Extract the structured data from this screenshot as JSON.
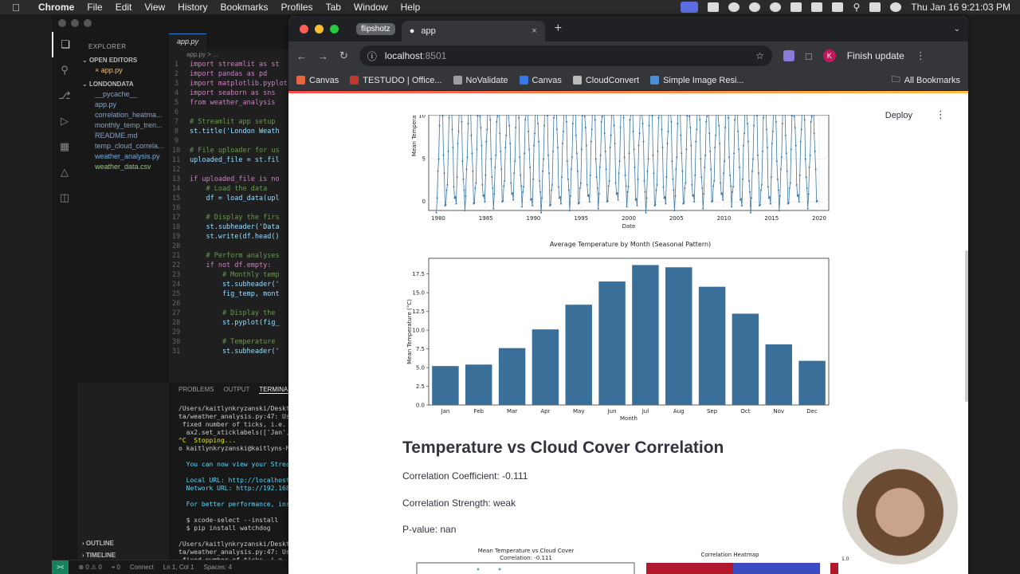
{
  "menubar": {
    "app": "Chrome",
    "items": [
      "File",
      "Edit",
      "View",
      "History",
      "Bookmarks",
      "Profiles",
      "Tab",
      "Window",
      "Help"
    ],
    "clock": "Thu Jan 16  9:21:03 PM"
  },
  "vscode": {
    "explorer_title": "EXPLORER",
    "open_editors": "OPEN EDITORS",
    "open_file": "app.py",
    "project": "LONDONDATA",
    "files": [
      "__pycache__",
      "app.py",
      "correlation_heatma...",
      "monthly_temp_tren...",
      "README.md",
      "temp_cloud_correla...",
      "weather_analysis.py",
      "weather_data.csv"
    ],
    "tab_label": "app.py",
    "breadcrumb": "app.py > ...",
    "code_lines": [
      {
        "n": "1",
        "t": "import streamlit as st"
      },
      {
        "n": "2",
        "t": "import pandas as pd"
      },
      {
        "n": "3",
        "t": "import matplotlib.pyplot"
      },
      {
        "n": "4",
        "t": "import seaborn as sns"
      },
      {
        "n": "5",
        "t": "from weather_analysis"
      },
      {
        "n": "6",
        "t": ""
      },
      {
        "n": "7",
        "t": "# Streamlit app setup"
      },
      {
        "n": "8",
        "t": "st.title('London Weath"
      },
      {
        "n": "9",
        "t": ""
      },
      {
        "n": "10",
        "t": "# File uploader for us"
      },
      {
        "n": "11",
        "t": "uploaded_file = st.fil"
      },
      {
        "n": "12",
        "t": ""
      },
      {
        "n": "13",
        "t": "if uploaded_file is no"
      },
      {
        "n": "14",
        "t": "    # Load the data"
      },
      {
        "n": "15",
        "t": "    df = load_data(upl"
      },
      {
        "n": "16",
        "t": ""
      },
      {
        "n": "17",
        "t": "    # Display the firs"
      },
      {
        "n": "18",
        "t": "    st.subheader('Data"
      },
      {
        "n": "19",
        "t": "    st.write(df.head()"
      },
      {
        "n": "20",
        "t": ""
      },
      {
        "n": "21",
        "t": "    # Perform analyses"
      },
      {
        "n": "22",
        "t": "    if not df.empty:"
      },
      {
        "n": "23",
        "t": "        # Monthly temp"
      },
      {
        "n": "24",
        "t": "        st.subheader('"
      },
      {
        "n": "25",
        "t": "        fig_temp, mont"
      },
      {
        "n": "26",
        "t": ""
      },
      {
        "n": "27",
        "t": "        # Display the"
      },
      {
        "n": "28",
        "t": "        st.pyplot(fig_"
      },
      {
        "n": "29",
        "t": ""
      },
      {
        "n": "30",
        "t": "        # Temperature"
      },
      {
        "n": "31",
        "t": "        st.subheader('"
      }
    ],
    "panel_tabs": [
      "PROBLEMS",
      "OUTPUT",
      "TERMINAL"
    ],
    "terminal_lines": [
      "/Users/kaitlynkryzanski/Deskt",
      "ta/weather_analysis.py:47: Us",
      " fixed number of ticks, i.e.",
      "  ax2.set_xticklabels(['Jan',",
      "^C  Stopping...",
      "o kaitlynkryzanski@kaitlyns-MBP",
      "",
      "  You can now view your Strea",
      "",
      "  Local URL: http://localhost",
      "  Network URL: http://192.168",
      "",
      "  For better performance, ins",
      "",
      "  $ xcode-select --install",
      "  $ pip install watchdog",
      "",
      "/Users/kaitlynkryzanski/Deskt",
      "ta/weather_analysis.py:47: Us",
      " fixed number of ticks, i.e.",
      "  ax2.set_xticklabels(['Jan',"
    ],
    "outline": "OUTLINE",
    "timeline": "TIMELINE",
    "status": {
      "errors": "0",
      "warnings": "0",
      "ports": "0",
      "connect": "Connect",
      "position": "Ln 1, Col 1",
      "spaces": "Spaces: 4"
    }
  },
  "chrome": {
    "tab_group": "flipshotz",
    "tab_title": "app",
    "url_host": "localhost",
    "url_port": ":8501",
    "finish_update": "Finish update",
    "avatar_letter": "K",
    "bookmarks": [
      {
        "label": "Canvas",
        "color": "#e8663d"
      },
      {
        "label": "TESTUDO | Office...",
        "color": "#c0392b"
      },
      {
        "label": "NoValidate",
        "color": "#9e9e9e"
      },
      {
        "label": "Canvas",
        "color": "#3b78e7"
      },
      {
        "label": "CloudConvert",
        "color": "#bbbbbb"
      },
      {
        "label": "Simple Image Resi...",
        "color": "#4a90d9"
      }
    ],
    "all_bookmarks": "All Bookmarks"
  },
  "streamlit": {
    "deploy": "Deploy",
    "heading": "Temperature vs Cloud Cover Correlation",
    "coefficient": "Correlation Coefficient: -0.111",
    "strength": "Correlation Strength: weak",
    "pvalue": "P-value: nan",
    "scatter_title_1": "Mean Temperature vs Cloud Cover",
    "scatter_title_2": "Correlation: -0.111",
    "heatmap_title": "Correlation Heatmap",
    "heatmap_scale_top": "1.0"
  },
  "chart_data": [
    {
      "type": "line",
      "title": "",
      "xlabel": "Date",
      "ylabel": "Mean Temperat",
      "x_ticks": [
        "1980",
        "1985",
        "1990",
        "1995",
        "2000",
        "2005",
        "2010",
        "2015",
        "2020"
      ],
      "y_ticks": [
        "0",
        "5",
        "10"
      ],
      "xlim": [
        1979,
        2021
      ],
      "ylim": [
        -1,
        12
      ],
      "color": "#3a78a8"
    },
    {
      "type": "bar",
      "title": "Average Temperature by Month (Seasonal Pattern)",
      "xlabel": "Month",
      "ylabel": "Mean Temperature (°C)",
      "categories": [
        "Jan",
        "Feb",
        "Mar",
        "Apr",
        "May",
        "Jun",
        "Jul",
        "Aug",
        "Sep",
        "Oct",
        "Nov",
        "Dec"
      ],
      "values": [
        5.2,
        5.4,
        7.6,
        10.1,
        13.4,
        16.5,
        18.7,
        18.4,
        15.8,
        12.2,
        8.1,
        5.9
      ],
      "y_ticks": [
        "0.0",
        "2.5",
        "5.0",
        "7.5",
        "10.0",
        "12.5",
        "15.0",
        "17.5"
      ],
      "ylim": [
        0,
        19.6
      ],
      "color": "#3a6f9a"
    }
  ]
}
